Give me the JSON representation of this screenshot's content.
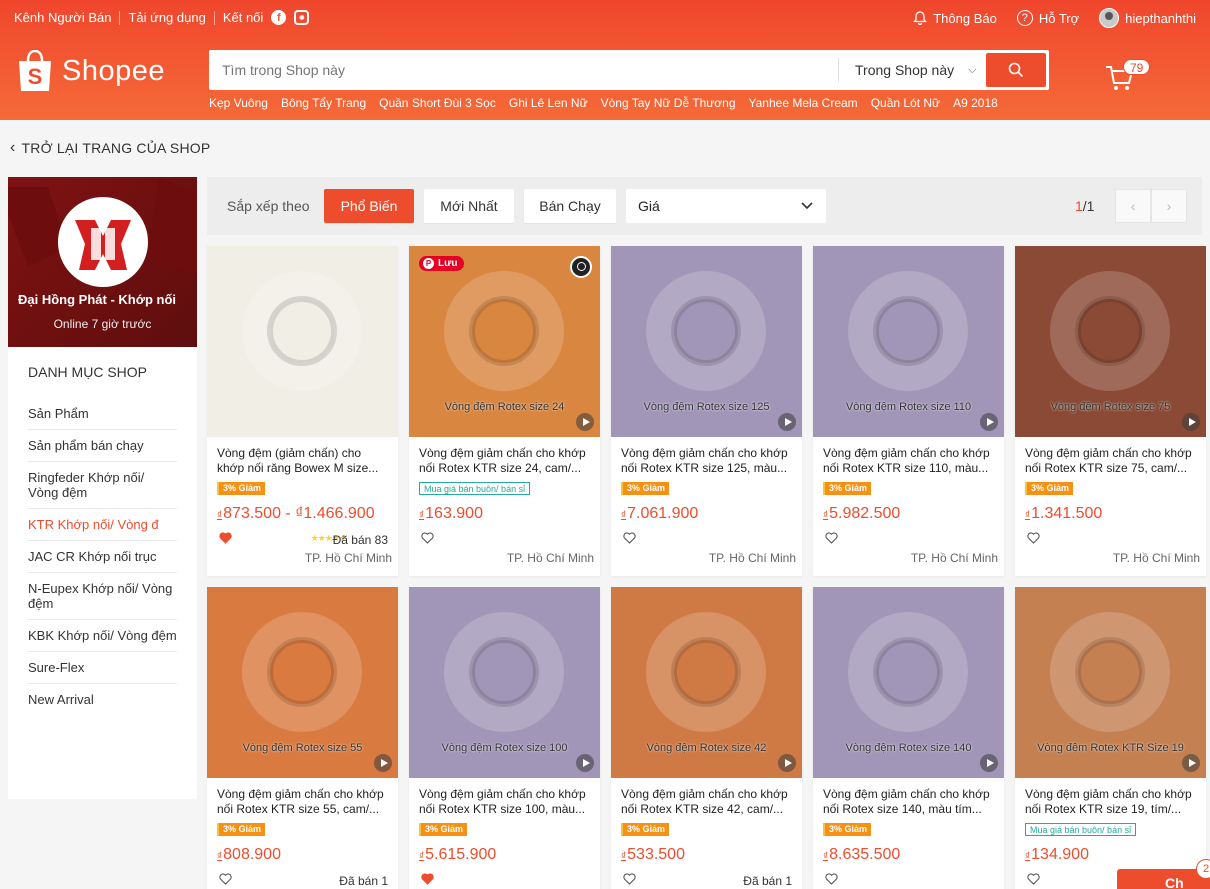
{
  "topbar": {
    "left_links": [
      "Kênh Người Bán",
      "Tải ứng dụng",
      "Kết nối"
    ],
    "notifications_label": "Thông Báo",
    "help_label": "Hỗ Trợ",
    "username": "hiepthanhthi"
  },
  "brand": {
    "logo_text": "Shopee"
  },
  "search": {
    "placeholder": "Tìm trong Shop này",
    "scope": "Trong Shop này"
  },
  "suggestions": [
    "Kẹp Vuông",
    "Bông Tẩy Trang",
    "Quần Short Đùi 3 Sọc",
    "Ghi Lê Len Nữ",
    "Vòng Tay Nữ Dễ Thương",
    "Yanhee Mela Cream",
    "Quần Lót Nữ",
    "A9 2018"
  ],
  "cart": {
    "count": "79"
  },
  "back_link": "TRỞ LẠI TRANG CỦA SHOP",
  "shop": {
    "name": "Đại Hồng Phát - Khớp nối",
    "online": "Online 7 giờ trước"
  },
  "categories": {
    "title": "DANH MỤC SHOP",
    "items": [
      {
        "label": "Sản Phẩm",
        "active": false
      },
      {
        "label": "Sản phẩm bán chạy",
        "active": false
      },
      {
        "label": "Ringfeder Khớp nối/ Vòng đệm",
        "active": false
      },
      {
        "label": "KTR Khớp nối/ Vòng đ",
        "active": true
      },
      {
        "label": "JAC CR Khớp nối trục",
        "active": false
      },
      {
        "label": "N-Eupex Khớp nối/ Vòng đệm",
        "active": false
      },
      {
        "label": "KBK Khớp nối/ Vòng đệm",
        "active": false
      },
      {
        "label": "Sure-Flex",
        "active": false
      },
      {
        "label": "New Arrival",
        "active": false
      }
    ]
  },
  "sortbar": {
    "label": "Sắp xếp theo",
    "options": [
      "Phổ Biến",
      "Mới Nhất",
      "Bán Chạy"
    ],
    "active": "Phổ Biến",
    "price_label": "Giá",
    "page_current": "1",
    "page_total": "/1"
  },
  "colors": {
    "accent": "#ee4d2d",
    "discount": "#f69113",
    "wholesale": "#26aa99"
  },
  "products": [
    {
      "title": "Vòng đệm (giảm chấn) cho khớp nối răng Bowex M size...",
      "tag": "3% Giảm",
      "tag_type": "discount",
      "price": "873.500 - ₫1.466.900",
      "liked": true,
      "rating_stars": "★★★★★",
      "sold": "Đã bán 83",
      "location": "TP. Hồ Chí Minh",
      "image_color": "#f1eee6",
      "image_text": "",
      "has_play": false,
      "has_pin": false,
      "pin_label": ""
    },
    {
      "title": "Vòng đệm giảm chấn cho khớp nối Rotex KTR size 24, cam/...",
      "tag": "Mua giá bán buôn/ bán sỉ",
      "tag_type": "wholesale",
      "price": "163.900",
      "liked": false,
      "rating_stars": "",
      "sold": "",
      "location": "TP. Hồ Chí Minh",
      "image_color": "#d98640",
      "image_text": "Vòng đệm Rotex size 24",
      "has_play": true,
      "has_pin": true,
      "pin_label": "Lưu"
    },
    {
      "title": "Vòng đệm giảm chấn cho khớp nối Rotex KTR size 125, màu...",
      "tag": "3% Giảm",
      "tag_type": "discount",
      "price": "7.061.900",
      "liked": false,
      "rating_stars": "",
      "sold": "",
      "location": "TP. Hồ Chí Minh",
      "image_color": "#a196b8",
      "image_text": "Vòng đệm Rotex size 125",
      "has_play": true,
      "has_pin": false,
      "pin_label": ""
    },
    {
      "title": "Vòng đệm giảm chấn cho khớp nối Rotex KTR size 110, màu...",
      "tag": "3% Giảm",
      "tag_type": "discount",
      "price": "5.982.500",
      "liked": false,
      "rating_stars": "",
      "sold": "",
      "location": "TP. Hồ Chí Minh",
      "image_color": "#a196b8",
      "image_text": "Vòng đệm Rotex size 110",
      "has_play": true,
      "has_pin": false,
      "pin_label": ""
    },
    {
      "title": "Vòng đệm giảm chấn cho khớp nối Rotex KTR size 75, cam/...",
      "tag": "3% Giảm",
      "tag_type": "discount",
      "price": "1.341.500",
      "liked": false,
      "rating_stars": "",
      "sold": "",
      "location": "TP. Hồ Chí Minh",
      "image_color": "#8a4a35",
      "image_text": "Vòng đệm Rotex size 75",
      "has_play": true,
      "has_pin": false,
      "pin_label": ""
    },
    {
      "title": "Vòng đệm giảm chấn cho khớp nối Rotex KTR size 55, cam/...",
      "tag": "3% Giảm",
      "tag_type": "discount",
      "price": "808.900",
      "liked": false,
      "rating_stars": "",
      "sold": "Đã bán 1",
      "location": "",
      "image_color": "#d97a40",
      "image_text": "Vòng đệm Rotex size 55",
      "has_play": true,
      "has_pin": false,
      "pin_label": ""
    },
    {
      "title": "Vòng đệm giảm chấn cho khớp nối Rotex KTR size 100, màu...",
      "tag": "3% Giảm",
      "tag_type": "discount",
      "price": "5.615.900",
      "liked": true,
      "rating_stars": "",
      "sold": "",
      "location": "",
      "image_color": "#a196b8",
      "image_text": "Vòng đệm Rotex size 100",
      "has_play": true,
      "has_pin": false,
      "pin_label": ""
    },
    {
      "title": "Vòng đệm giảm chấn cho khớp nối Rotex KTR size 42, cam/...",
      "tag": "3% Giảm",
      "tag_type": "discount",
      "price": "533.500",
      "liked": false,
      "rating_stars": "",
      "sold": "Đã bán 1",
      "location": "",
      "image_color": "#cf7a45",
      "image_text": "Vòng đệm Rotex size 42",
      "has_play": true,
      "has_pin": false,
      "pin_label": ""
    },
    {
      "title": "Vòng đệm giảm chấn cho khớp nối Rotex size 140, màu tím...",
      "tag": "3% Giảm",
      "tag_type": "discount",
      "price": "8.635.500",
      "liked": false,
      "rating_stars": "",
      "sold": "",
      "location": "",
      "image_color": "#a196b8",
      "image_text": "Vòng đệm Rotex size 140",
      "has_play": true,
      "has_pin": false,
      "pin_label": ""
    },
    {
      "title": "Vòng đệm giảm chấn cho khớp nối Rotex KTR size 19, tím/...",
      "tag": "Mua giá bán buôn/ bán sỉ",
      "tag_type": "wholesale",
      "price": "134.900",
      "liked": false,
      "rating_stars": "★★★",
      "sold": "",
      "location": "",
      "image_color": "#c58052",
      "image_text": "Vòng đệm Rotex KTR Size 19",
      "has_play": true,
      "has_pin": false,
      "pin_label": ""
    }
  ],
  "price_currency": "₫",
  "chat": {
    "label": "Ch",
    "badge": "2"
  }
}
